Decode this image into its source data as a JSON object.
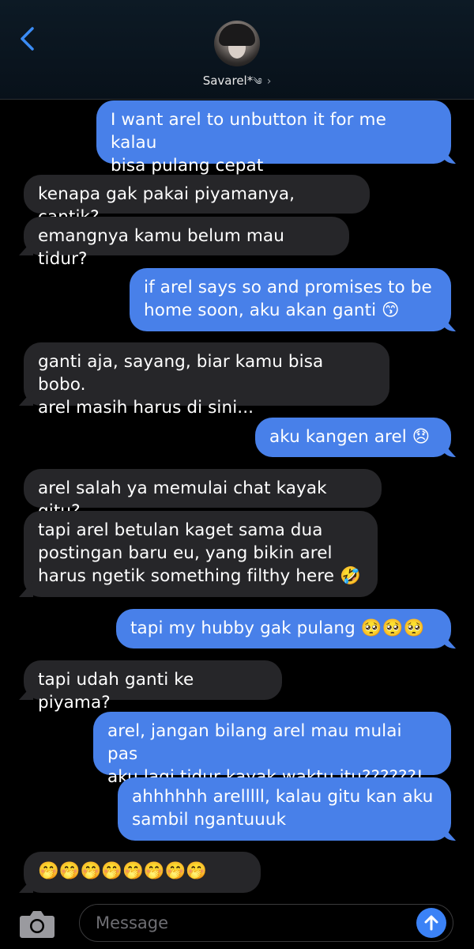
{
  "header": {
    "contact_name": "Savarel*",
    "contact_flourish": "༄",
    "contact_chevron": "›"
  },
  "messages": [
    {
      "side": "out",
      "text": "I want arel to unbutton it for me kalau\nbisa pulang cepat"
    },
    {
      "side": "in",
      "text": "kenapa gak pakai piyamanya, cantik?"
    },
    {
      "side": "in",
      "text": "emangnya kamu belum mau tidur?"
    },
    {
      "side": "out",
      "text": "if arel says so and promises to be\nhome soon, aku akan ganti 😙"
    },
    {
      "side": "in",
      "text": "ganti aja, sayang, biar kamu bisa bobo.\narel masih harus di sini..."
    },
    {
      "side": "out",
      "text": "aku kangen arel 😞"
    },
    {
      "side": "in",
      "text": "arel salah ya memulai chat kayak gitu?"
    },
    {
      "side": "in",
      "text": "tapi arel betulan kaget sama dua\npostingan baru eu, yang bikin arel\nharus ngetik something filthy here 🤣"
    },
    {
      "side": "out",
      "text": "tapi my hubby gak pulang 🥺🥺🥺"
    },
    {
      "side": "in",
      "text": "tapi udah ganti ke piyama?"
    },
    {
      "side": "out",
      "text": "arel, jangan bilang arel mau mulai pas\naku lagi tidur kayak waktu itu??????!"
    },
    {
      "side": "out",
      "text": "ahhhhhh arelllll, kalau gitu kan aku\nsambil ngantuuuk"
    },
    {
      "side": "in",
      "text": "🤭🤭🤭🤭🤭🤭🤭🤭"
    }
  ],
  "composer": {
    "placeholder": "Message"
  },
  "colors": {
    "outgoing_bubble": "#4880e9",
    "incoming_bubble": "#262629",
    "accent": "#3b82f6"
  }
}
